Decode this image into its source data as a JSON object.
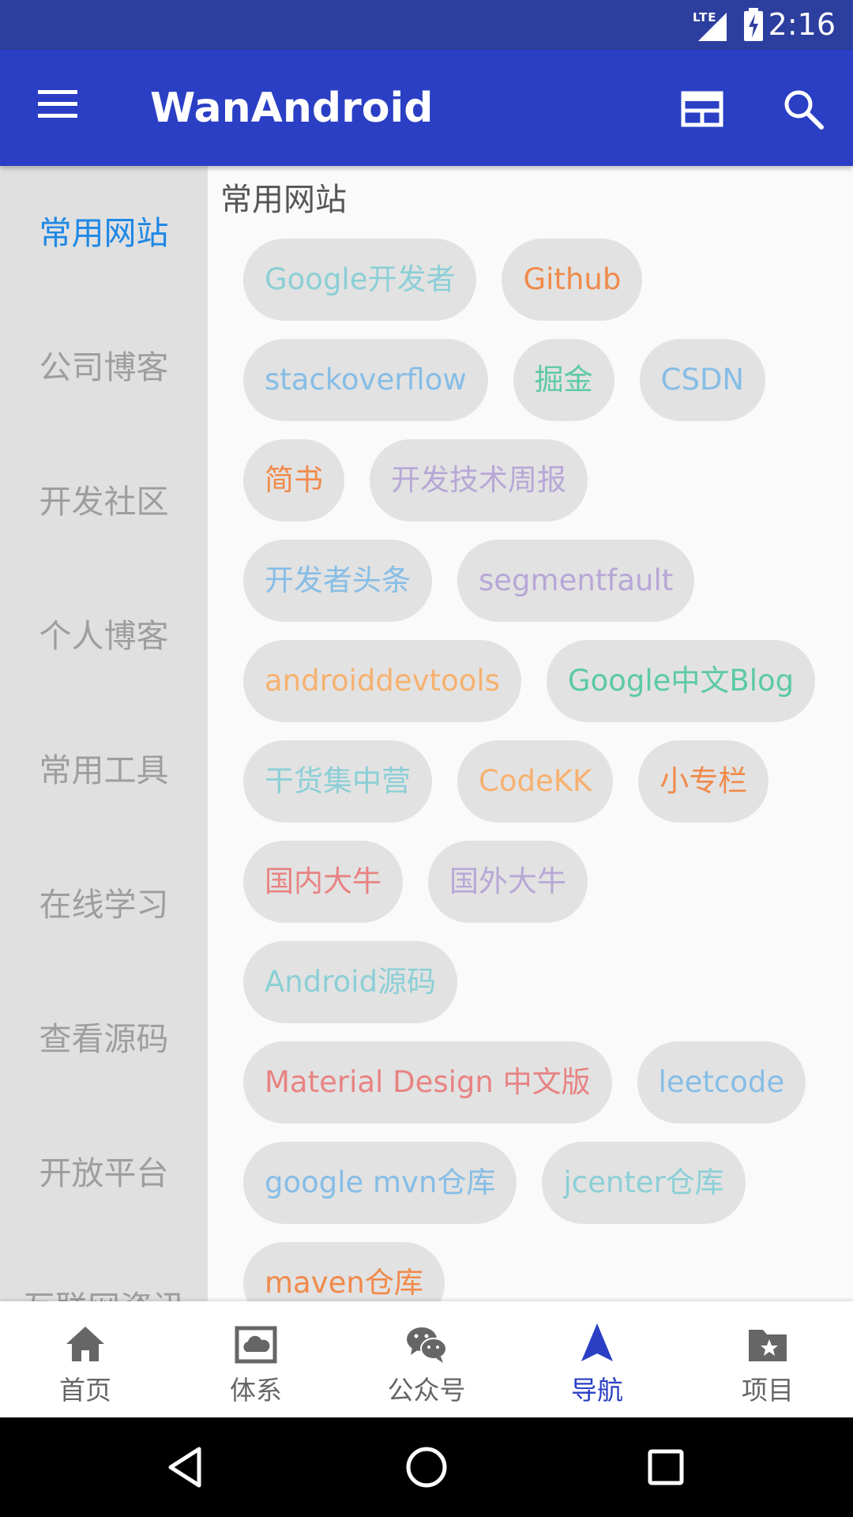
{
  "status_bar": {
    "time": "2:16",
    "network": "LTE"
  },
  "app_bar": {
    "title": "WanAndroid",
    "menu_icon": "menu-icon",
    "web_icon": "web-icon",
    "search_icon": "search-icon"
  },
  "sidebar": {
    "items": [
      {
        "label": "常用网站",
        "active": true
      },
      {
        "label": "公司博客",
        "active": false
      },
      {
        "label": "开发社区",
        "active": false
      },
      {
        "label": "个人博客",
        "active": false
      },
      {
        "label": "常用工具",
        "active": false
      },
      {
        "label": "在线学习",
        "active": false
      },
      {
        "label": "查看源码",
        "active": false
      },
      {
        "label": "开放平台",
        "active": false
      },
      {
        "label": "互联网资讯",
        "active": false
      }
    ]
  },
  "content": {
    "section_title": "常用网站",
    "rows": [
      [
        {
          "label": "Google开发者",
          "color": "#8ccfd6"
        },
        {
          "label": "Github",
          "color": "#f08a4b"
        }
      ],
      [
        {
          "label": "stackoverflow",
          "color": "#86bde6"
        },
        {
          "label": "掘金",
          "color": "#5cc9a7"
        },
        {
          "label": "CSDN",
          "color": "#86bde6"
        }
      ],
      [
        {
          "label": "简书",
          "color": "#f08a4b"
        },
        {
          "label": "开发技术周报",
          "color": "#b7a7d6"
        }
      ],
      [
        {
          "label": "开发者头条",
          "color": "#86bde6"
        },
        {
          "label": "segmentfault",
          "color": "#b7a7d6"
        }
      ],
      [
        {
          "label": "androiddevtools",
          "color": "#f6b16f"
        },
        {
          "label": "Google中文Blog",
          "color": "#5cc9a7"
        }
      ],
      [
        {
          "label": "干货集中营",
          "color": "#8ccfd6"
        },
        {
          "label": "CodeKK",
          "color": "#f6b16f"
        },
        {
          "label": "小专栏",
          "color": "#f08a4b"
        }
      ],
      [
        {
          "label": "国内大牛",
          "color": "#e88383"
        },
        {
          "label": "国外大牛",
          "color": "#b7a7d6"
        }
      ],
      [
        {
          "label": "Android源码",
          "color": "#8ccfd6"
        }
      ],
      [
        {
          "label": "Material Design 中文版",
          "color": "#e88383"
        },
        {
          "label": "leetcode",
          "color": "#86bde6"
        }
      ],
      [
        {
          "label": "google mvn仓库",
          "color": "#86bde6"
        },
        {
          "label": "jcenter仓库",
          "color": "#8ccfd6"
        }
      ],
      [
        {
          "label": "maven仓库",
          "color": "#f08a4b"
        }
      ]
    ]
  },
  "bottom_nav": {
    "items": [
      {
        "label": "首页",
        "icon": "home-icon",
        "active": false
      },
      {
        "label": "体系",
        "icon": "cloud-icon",
        "active": false
      },
      {
        "label": "公众号",
        "icon": "wechat-icon",
        "active": false
      },
      {
        "label": "导航",
        "icon": "navigation-icon",
        "active": true
      },
      {
        "label": "项目",
        "icon": "folder-star-icon",
        "active": false
      }
    ]
  },
  "system_nav": {
    "back_icon": "back-icon",
    "home_icon": "home-circle-icon",
    "recents_icon": "recents-icon"
  },
  "colors": {
    "primary": "#2a3fc4",
    "primary_dark": "#2c3e9e",
    "accent": "#1e88e5"
  }
}
